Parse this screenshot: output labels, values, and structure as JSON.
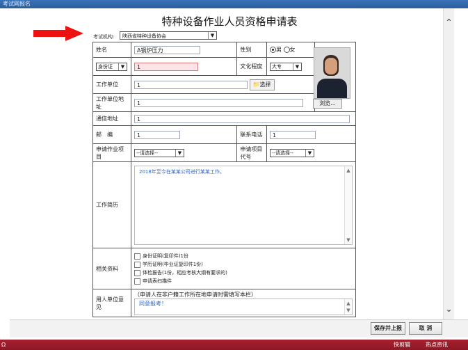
{
  "window": {
    "title": "考试网报名"
  },
  "form": {
    "title": "特种设备作业人员资格申请表",
    "exam_org_label": "考试机构:",
    "exam_org_value": "陕西省特种设备协会",
    "name_label": "姓名",
    "name_value": "A锅炉压力",
    "gender_label": "性别",
    "gender_male": "男",
    "gender_female": "女",
    "id_type_value": "身份证",
    "id_number_value": "1",
    "education_label": "文化程度",
    "education_value": "大专",
    "work_unit_label": "工作单位",
    "work_unit_value": "1",
    "select_button": "选择",
    "work_unit_address_label": "工作单位地址",
    "work_unit_address_value": "1",
    "browse_button": "浏览...",
    "mail_address_label": "通信地址",
    "mail_address_value": "1",
    "postcode_label": "邮　编",
    "postcode_value": "1",
    "phone_label": "联系电话",
    "phone_value": "1",
    "apply_item_label": "申请作业项目",
    "apply_item_value": "--请选择--",
    "apply_code_label": "申请项目代号",
    "apply_code_value": "--请选择--",
    "resume_label": "工作简历",
    "resume_value": "2018年至今在某某公司进行某某工作。",
    "materials_label": "相关资料",
    "materials": [
      "身份证明(复印件)1份",
      "学历证明(毕业证复印件1份)",
      "体检报告(1份，相应考核大纲有要求的)",
      "申请表扫描件"
    ],
    "employer_opinion_label": "用人单位意见",
    "employer_opinion_note": "（申请人在非户籍工作所在地申请时需填写本栏）",
    "employer_opinion_value": "同意报考！"
  },
  "footer": {
    "submit_button": "保存并上报",
    "close_button": "取 消"
  },
  "taskbar": {
    "left_text": "Ω",
    "item1": "快剪辑",
    "item2": "热点资讯"
  },
  "colors": {
    "arrow": "#ee1111",
    "taskbar": "#9b1c2a",
    "titlebar": "#2f65a8",
    "id_input_bg": "#fde4e8"
  }
}
